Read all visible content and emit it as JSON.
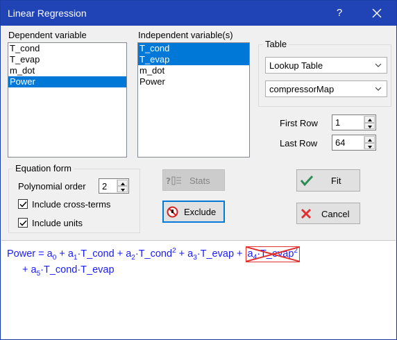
{
  "window": {
    "title": "Linear Regression",
    "help_label": "?"
  },
  "dependent": {
    "label": "Dependent variable",
    "items": [
      "T_cond",
      "T_evap",
      "m_dot",
      "Power"
    ],
    "selected": [
      "Power"
    ]
  },
  "independent": {
    "label": "Independent variable(s)",
    "items": [
      "T_cond",
      "T_evap",
      "m_dot",
      "Power"
    ],
    "selected": [
      "T_cond",
      "T_evap"
    ]
  },
  "table": {
    "label": "Table",
    "type_value": "Lookup Table",
    "name_value": "compressorMap",
    "first_row_label": "First Row",
    "first_row": "1",
    "last_row_label": "Last Row",
    "last_row": "64"
  },
  "equation_form": {
    "label": "Equation form",
    "poly_order_label": "Polynomial order",
    "poly_order": "2",
    "cross_terms_label": "Include cross-terms",
    "cross_terms_checked": true,
    "units_label": "Include units",
    "units_checked": true
  },
  "buttons": {
    "stats": "Stats",
    "exclude": "Exclude",
    "fit": "Fit",
    "cancel": "Cancel"
  },
  "equation": {
    "lhs": "Power",
    "eq": "=",
    "line1": [
      {
        "coef": "a",
        "sub": "0",
        "sep": "",
        "var": "",
        "sup": ""
      },
      {
        "coef": "a",
        "sub": "1",
        "sep": "·",
        "var": "T_cond",
        "sup": ""
      },
      {
        "coef": "a",
        "sub": "2",
        "sep": "·",
        "var": "T_cond",
        "sup": "2"
      },
      {
        "coef": "a",
        "sub": "3",
        "sep": "·",
        "var": "T_evap",
        "sup": ""
      },
      {
        "coef": "a",
        "sub": "4",
        "sep": "·",
        "var": "T_evap",
        "sup": "2",
        "excluded": true
      }
    ],
    "line2": [
      {
        "coef": "a",
        "sub": "5",
        "sep": "·",
        "var": "T_cond·T_evap",
        "sup": ""
      }
    ],
    "plus": "+",
    "color": "#1a1aff",
    "excluded_color": "#e03030"
  }
}
